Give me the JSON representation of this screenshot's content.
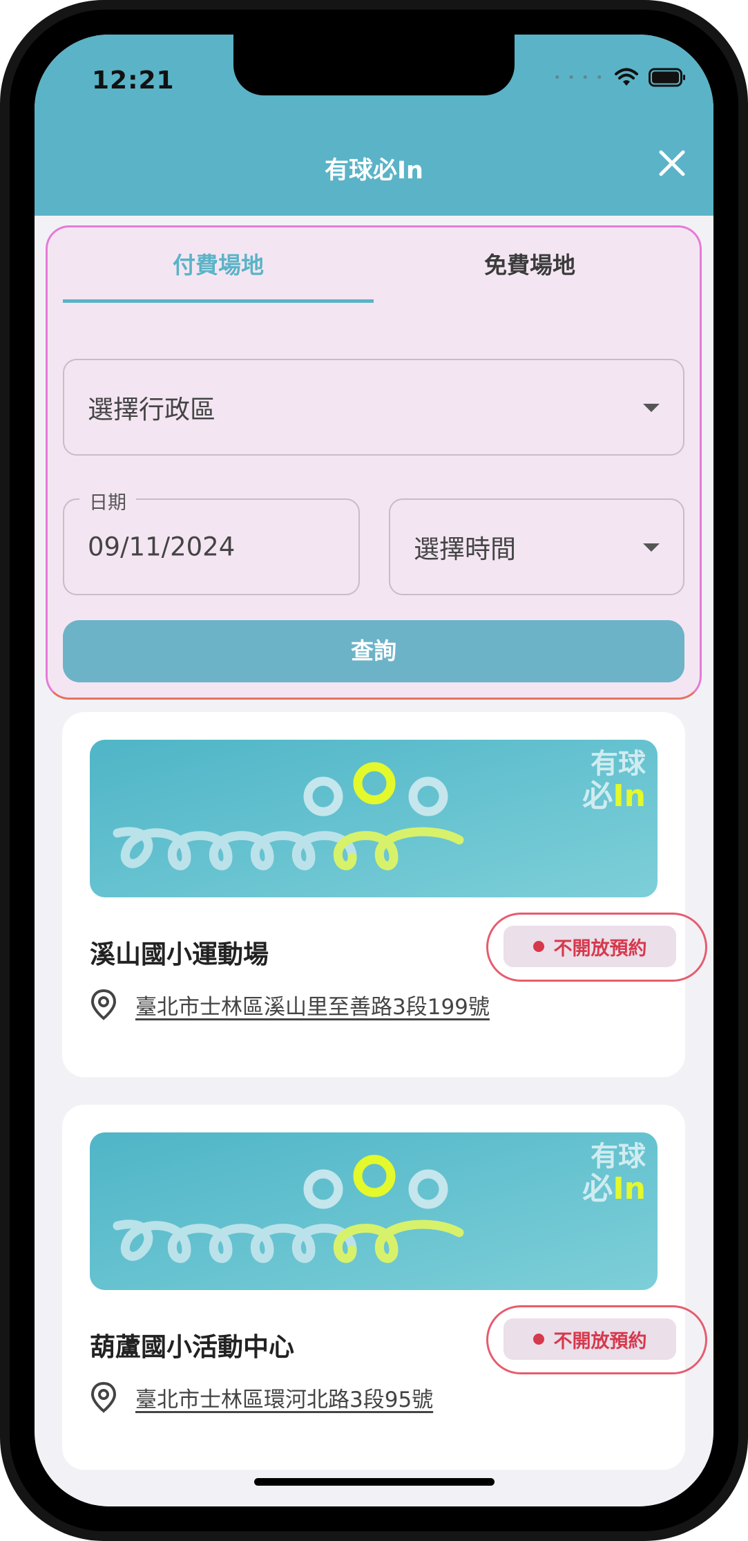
{
  "status_bar": {
    "time": "12:21"
  },
  "header": {
    "title": "有球必In",
    "close_icon": "close-icon"
  },
  "search": {
    "tabs": [
      {
        "label": "付費場地",
        "active": true
      },
      {
        "label": "免費場地",
        "active": false
      }
    ],
    "district_select": {
      "value": "選擇行政區"
    },
    "date_field": {
      "label": "日期",
      "value": "09/11/2024"
    },
    "time_select": {
      "value": "選擇時間"
    },
    "search_button": "查詢"
  },
  "banner": {
    "line1": "有球",
    "line2_prefix": "必",
    "line2_suffix": "In"
  },
  "venues": [
    {
      "name": "溪山國小運動場",
      "status": "不開放預約",
      "address": "臺北市士林區溪山里至善路3段199號"
    },
    {
      "name": "葫蘆國小活動中心",
      "status": "不開放預約",
      "address": "臺北市士林區環河北路3段95號"
    }
  ],
  "colors": {
    "accent": "#5bb3c7",
    "panel": "#f3e6f2",
    "status_red": "#d6384c",
    "logo_yellow": "#e3f92b"
  }
}
